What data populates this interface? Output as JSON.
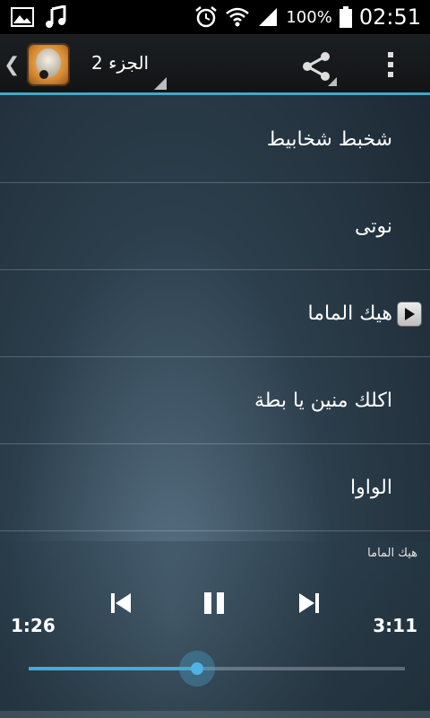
{
  "status_bar": {
    "icons": [
      "image-icon",
      "music-note-icon",
      "alarm-icon",
      "wifi-icon",
      "signal-icon",
      "battery-icon"
    ],
    "battery": "100%",
    "time": "02:51"
  },
  "action_bar": {
    "title": "الجزء 2",
    "icons": [
      "back-chevron-icon",
      "app-logo",
      "share-icon",
      "overflow-menu-icon"
    ],
    "accent": "#4aa3c8"
  },
  "songs": [
    {
      "label": "شخبط شخابيط",
      "playing": false
    },
    {
      "label": "نوتى",
      "playing": false
    },
    {
      "label": "هيك الماما",
      "playing": true
    },
    {
      "label": "اكلك منين يا بطة",
      "playing": false
    },
    {
      "label": "الواوا",
      "playing": false
    }
  ],
  "player": {
    "now_playing": "هيك الماما",
    "elapsed": "1:26",
    "total": "3:11",
    "progress": 0.447,
    "icons": [
      "previous-icon",
      "pause-icon",
      "next-icon"
    ],
    "accent": "#4aa8d8"
  }
}
